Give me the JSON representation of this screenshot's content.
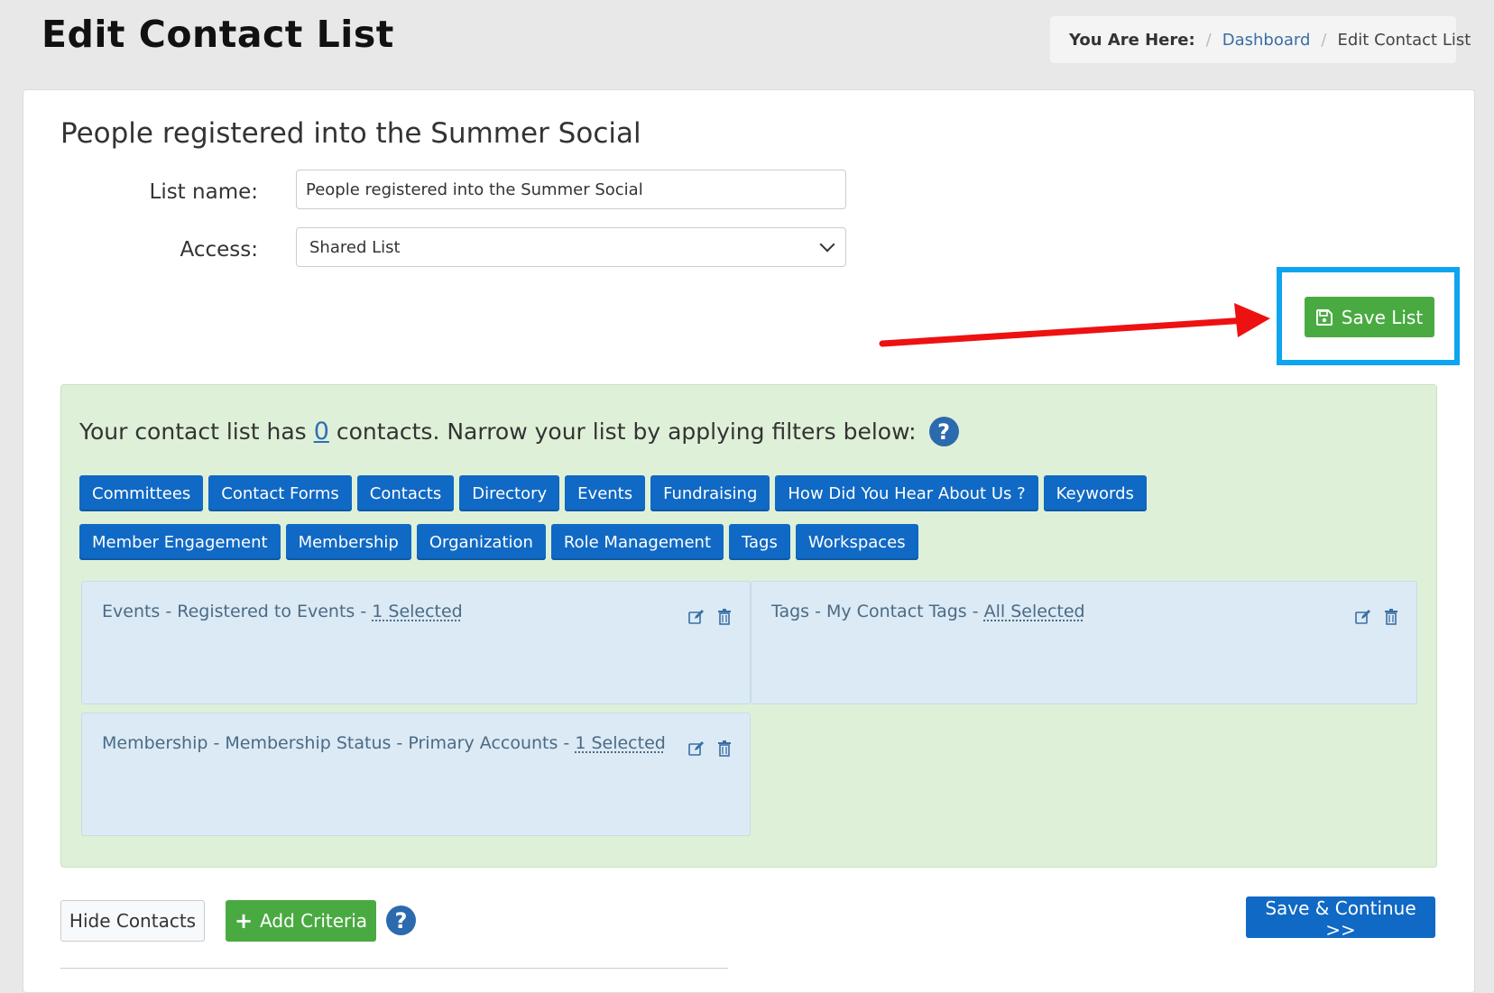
{
  "page": {
    "title": "Edit Contact List"
  },
  "breadcrumb": {
    "label": "You Are Here:",
    "separator": "/",
    "link": "Dashboard",
    "current": "Edit Contact List"
  },
  "list": {
    "heading": "People registered into the Summer Social",
    "name_label": "List name:",
    "name_value": "People registered into the Summer Social",
    "access_label": "Access:",
    "access_value": "Shared List"
  },
  "save_list": {
    "label": "Save List",
    "icon": "floppy-disk-icon"
  },
  "annotation": {
    "highlight_color": "#0ea5ef",
    "arrow_color": "#ee1111"
  },
  "filters": {
    "prefix": "Your contact list has",
    "count": "0",
    "suffix": "contacts. Narrow your list by applying filters below:",
    "help_icon": "?",
    "buttons": [
      "Committees",
      "Contact Forms",
      "Contacts",
      "Directory",
      "Events",
      "Fundraising",
      "How Did You Hear About Us ?",
      "Keywords",
      "Member Engagement",
      "Membership",
      "Organization",
      "Role Management",
      "Tags",
      "Workspaces"
    ]
  },
  "criteria": [
    {
      "text": "Events - Registered to Events - ",
      "selection": "1 Selected"
    },
    {
      "text": "Tags - My Contact Tags - ",
      "selection": "All Selected"
    },
    {
      "text": "Membership - Membership Status - Primary Accounts - ",
      "selection": "1 Selected"
    }
  ],
  "footer": {
    "hide_contacts": "Hide Contacts",
    "add_criteria": "Add Criteria",
    "add_icon": "+",
    "help_icon": "?",
    "save_continue": "Save & Continue >>"
  },
  "colors": {
    "primary_blue": "#1069c4",
    "success_green": "#4aaa42",
    "panel_green": "#dff0d8",
    "criteria_blue": "#dbeaf4"
  }
}
